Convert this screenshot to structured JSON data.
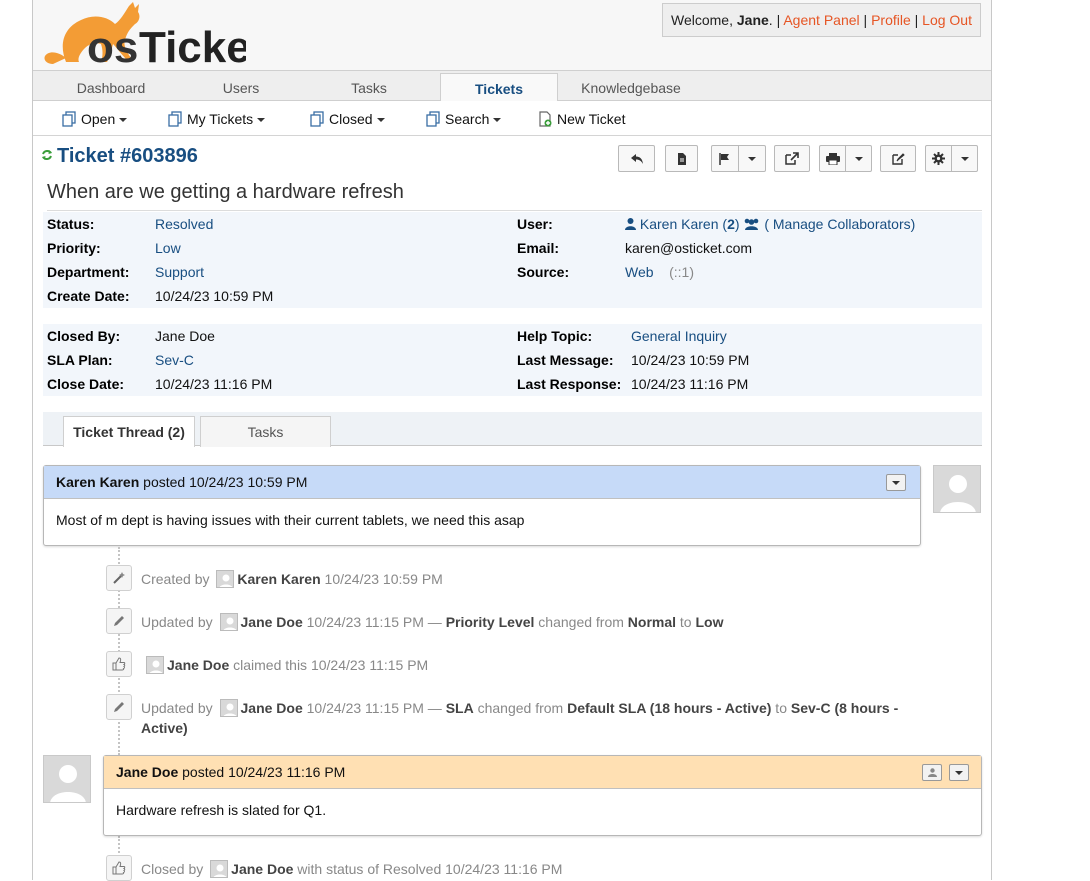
{
  "header": {
    "logo_text": "osTicket",
    "welcome_prefix": "Welcome, ",
    "user_name": "Jane",
    "welcome_suffix": ". | ",
    "agent_panel": "Agent Panel",
    "sep": " | ",
    "profile": "Profile",
    "logout": "Log Out"
  },
  "tabs": [
    "Dashboard",
    "Users",
    "Tasks",
    "Tickets",
    "Knowledgebase"
  ],
  "subnav": {
    "open": "Open",
    "my_tickets": "My Tickets",
    "closed": "Closed",
    "search": "Search",
    "new_ticket": "New Ticket"
  },
  "ticket": {
    "number": "Ticket #603896",
    "subject": "When are we getting a hardware refresh",
    "status_label": "Status:",
    "status": "Resolved",
    "priority_label": "Priority:",
    "priority": "Low",
    "department_label": "Department:",
    "department": "Support",
    "create_date_label": "Create Date:",
    "create_date": "10/24/23 10:59 PM",
    "user_label": "User:",
    "user": "Karen Karen",
    "user_count": "2",
    "manage_collaborators": "( Manage Collaborators)",
    "email_label": "Email:",
    "email": "karen@osticket.com",
    "source_label": "Source:",
    "source": "Web",
    "source_ip": "(::1)",
    "closed_by_label": "Closed By:",
    "closed_by": "Jane Doe",
    "sla_label": "SLA Plan:",
    "sla": "Sev-C",
    "close_date_label": "Close Date:",
    "close_date": "10/24/23 11:16 PM",
    "help_topic_label": "Help Topic:",
    "help_topic": "General Inquiry",
    "last_message_label": "Last Message:",
    "last_message": "10/24/23 10:59 PM",
    "last_response_label": "Last Response:",
    "last_response": "10/24/23 11:16 PM"
  },
  "thread_tabs": {
    "thread": "Ticket Thread (2)",
    "tasks": "Tasks"
  },
  "messages": [
    {
      "author": "Karen Karen",
      "posted": " posted 10/24/23 10:59 PM",
      "body": "Most of m dept is having issues with their current tablets, we need this asap",
      "color": "#c6daf8"
    },
    {
      "author": "Jane Doe",
      "posted": " posted 10/24/23 11:16 PM",
      "body": "Hardware refresh is slated for Q1.",
      "color": "#ffe0b3"
    }
  ],
  "events": {
    "e1": {
      "prefix": "Created by ",
      "actor": "Karen Karen",
      "time": " 10/24/23 10:59 PM"
    },
    "e2": {
      "prefix": "Updated by ",
      "actor": "Jane Doe",
      "time": " 10/24/23 11:15 PM — ",
      "field": "Priority Level",
      "mid": " changed from ",
      "from": "Normal",
      "to_word": " to ",
      "to": "Low"
    },
    "e3": {
      "actor": "Jane Doe",
      "text": " claimed this 10/24/23 11:15 PM"
    },
    "e4": {
      "prefix": "Updated by ",
      "actor": "Jane Doe",
      "time": " 10/24/23 11:15 PM — ",
      "field": "SLA",
      "mid": " changed from ",
      "from": "Default SLA (18 hours - Active)",
      "to_word": " to ",
      "to": "Sev-C (8 hours - Active)"
    },
    "e5": {
      "prefix": "Closed by ",
      "actor": "Jane Doe",
      "text": " with status of Resolved 10/24/23 11:16 PM"
    }
  },
  "colors": {
    "accent": "#184e81",
    "link_orange": "#e65524",
    "logo_orange": "#f39c35",
    "info_bg": "#f2f6fb"
  },
  "icons": {
    "refresh": "refresh-icon",
    "reply": "reply-icon",
    "note": "note-icon",
    "flag": "flag-icon",
    "share": "share-icon",
    "print": "print-icon",
    "edit": "edit-icon",
    "gear": "gear-icon"
  }
}
